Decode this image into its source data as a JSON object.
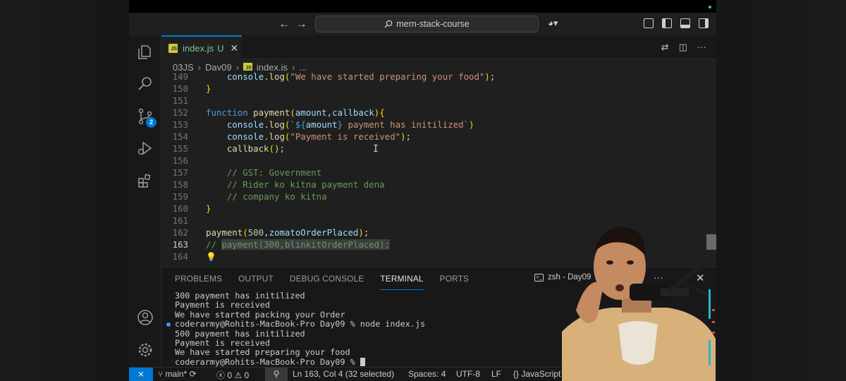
{
  "titlebar": {
    "search_text": "mern-stack-course"
  },
  "activity_bar": {
    "source_control_badge": "2",
    "icons": [
      "files-icon",
      "search-icon",
      "source-control-icon",
      "run-debug-icon",
      "extensions-icon",
      "account-icon",
      "manage-gear-icon"
    ]
  },
  "tab": {
    "file_name": "index.js",
    "status": "U",
    "lang_badge": "JS"
  },
  "breadcrumb": {
    "items": [
      "03JS",
      "Day09",
      "index.js",
      "..."
    ],
    "js_badge": "JS"
  },
  "editor": {
    "lines": [
      {
        "num": "149",
        "text": "    console.log(\"We have started preparing your food\");"
      },
      {
        "num": "150",
        "text": "}"
      },
      {
        "num": "151",
        "text": ""
      },
      {
        "num": "152",
        "text": "function payment(amount,callback){"
      },
      {
        "num": "153",
        "text": "    console.log(`${amount} payment has initilized`)"
      },
      {
        "num": "154",
        "text": "    console.log(\"Payment is received\");"
      },
      {
        "num": "155",
        "text": "    callback();"
      },
      {
        "num": "156",
        "text": ""
      },
      {
        "num": "157",
        "text": "    // GST: Government"
      },
      {
        "num": "158",
        "text": "    // Rider ko kitna payment dena"
      },
      {
        "num": "159",
        "text": "    // company ko kitna"
      },
      {
        "num": "160",
        "text": "}"
      },
      {
        "num": "161",
        "text": ""
      },
      {
        "num": "162",
        "text": "payment(500,zomatoOrderPlaced);"
      },
      {
        "num": "163",
        "text": "// payment(300,blinkitOrderPlaced);"
      },
      {
        "num": "164",
        "text": ""
      }
    ]
  },
  "panel": {
    "tabs": [
      "PROBLEMS",
      "OUTPUT",
      "DEBUG CONSOLE",
      "TERMINAL",
      "PORTS"
    ],
    "active_tab": "TERMINAL",
    "terminal_name": "zsh - Day09",
    "ellipsis": "···",
    "close": "✕"
  },
  "terminal": {
    "lines": [
      "300 payment has initilized",
      "Payment is received",
      "We have started packing your Order",
      "coderarmy@Rohits-MacBook-Pro Day09 % node index.js",
      "500 payment has initilized",
      "Payment is received",
      "We have started preparing your food",
      "coderarmy@Rohits-MacBook-Pro Day09 % "
    ]
  },
  "statusbar": {
    "branch": "main*",
    "errors": "0",
    "warnings": "0",
    "position": "Ln 163, Col 4 (32 selected)",
    "spaces": "Spaces: 4",
    "encoding": "UTF-8",
    "eol": "LF",
    "language": "JavaScript"
  },
  "colors": {
    "accent": "#0078d4",
    "untracked_green": "#73c991",
    "js_yellow": "#cbcb41"
  }
}
